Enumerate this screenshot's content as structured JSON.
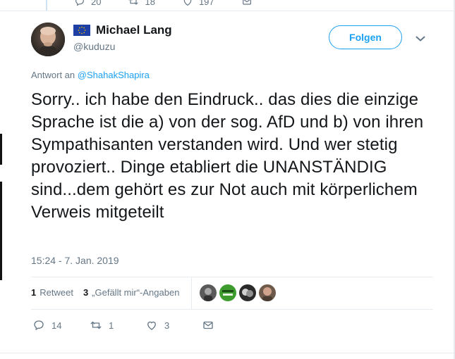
{
  "previous_tweet": {
    "reply_count": "20",
    "retweet_count": "18",
    "like_count": "197"
  },
  "author": {
    "display_name": "Michael Lang",
    "handle": "@kuduzu",
    "flag_icon": "eu-flag-icon"
  },
  "follow_button": {
    "label": "Folgen"
  },
  "more_icon": "chevron-down-icon",
  "reply_info": {
    "prefix": "Antwort an",
    "target": "@ShahakShapira"
  },
  "tweet": {
    "text": "Sorry.. ich habe den Eindruck.. das dies die einzige Sprache ist die a) von der sog. AfD und b) von ihren Sympathisanten verstanden wird. Und wer stetig provoziert.. Dinge etabliert die UNANSTÄNDIG sind...dem gehört es zur Not auch mit körperlichem Verweis mitgeteilt",
    "timestamp": "15:24 - 7. Jan. 2019"
  },
  "stats": {
    "retweet_count": "1",
    "retweet_label": "Retweet",
    "like_count": "3",
    "like_label": "„Gefällt mir“-Angaben"
  },
  "actions": {
    "reply_count": "14",
    "retweet_count": "1",
    "like_count": "3"
  },
  "colors": {
    "accent": "#1da1f2",
    "text": "#14171a",
    "secondary": "#657786",
    "divider": "#e6ecf0"
  }
}
